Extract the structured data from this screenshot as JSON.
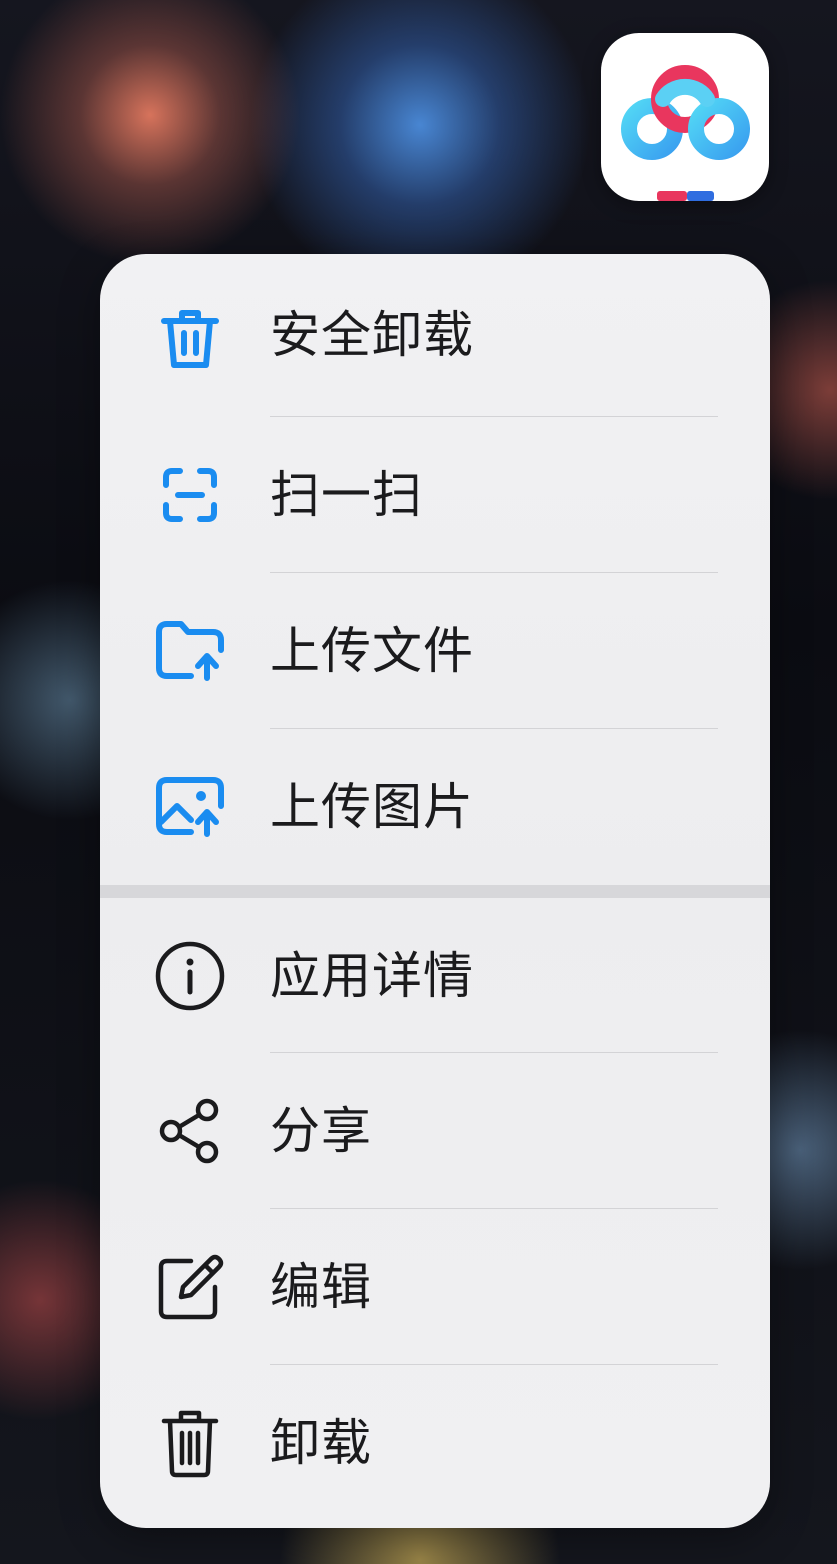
{
  "menu": {
    "group1": [
      {
        "label": "安全卸载",
        "icon": "trash-can-icon",
        "color": "#1a8cf0"
      },
      {
        "label": "扫一扫",
        "icon": "scan-icon",
        "color": "#1a8cf0"
      },
      {
        "label": "上传文件",
        "icon": "folder-upload-icon",
        "color": "#1a8cf0"
      },
      {
        "label": "上传图片",
        "icon": "image-upload-icon",
        "color": "#1a8cf0"
      }
    ],
    "group2": [
      {
        "label": "应用详情",
        "icon": "info-icon",
        "color": "#1b1b1d"
      },
      {
        "label": "分享",
        "icon": "share-icon",
        "color": "#1b1b1d"
      },
      {
        "label": "编辑",
        "icon": "edit-icon",
        "color": "#1b1b1d"
      },
      {
        "label": "卸载",
        "icon": "trash-icon",
        "color": "#1b1b1d"
      }
    ]
  },
  "app_icon": {
    "icon": "baidu-netdisk-logo-icon"
  },
  "colors": {
    "accent": "#1a8cf0",
    "text": "#1b1b1d",
    "menu_bg": "#efeff1"
  }
}
